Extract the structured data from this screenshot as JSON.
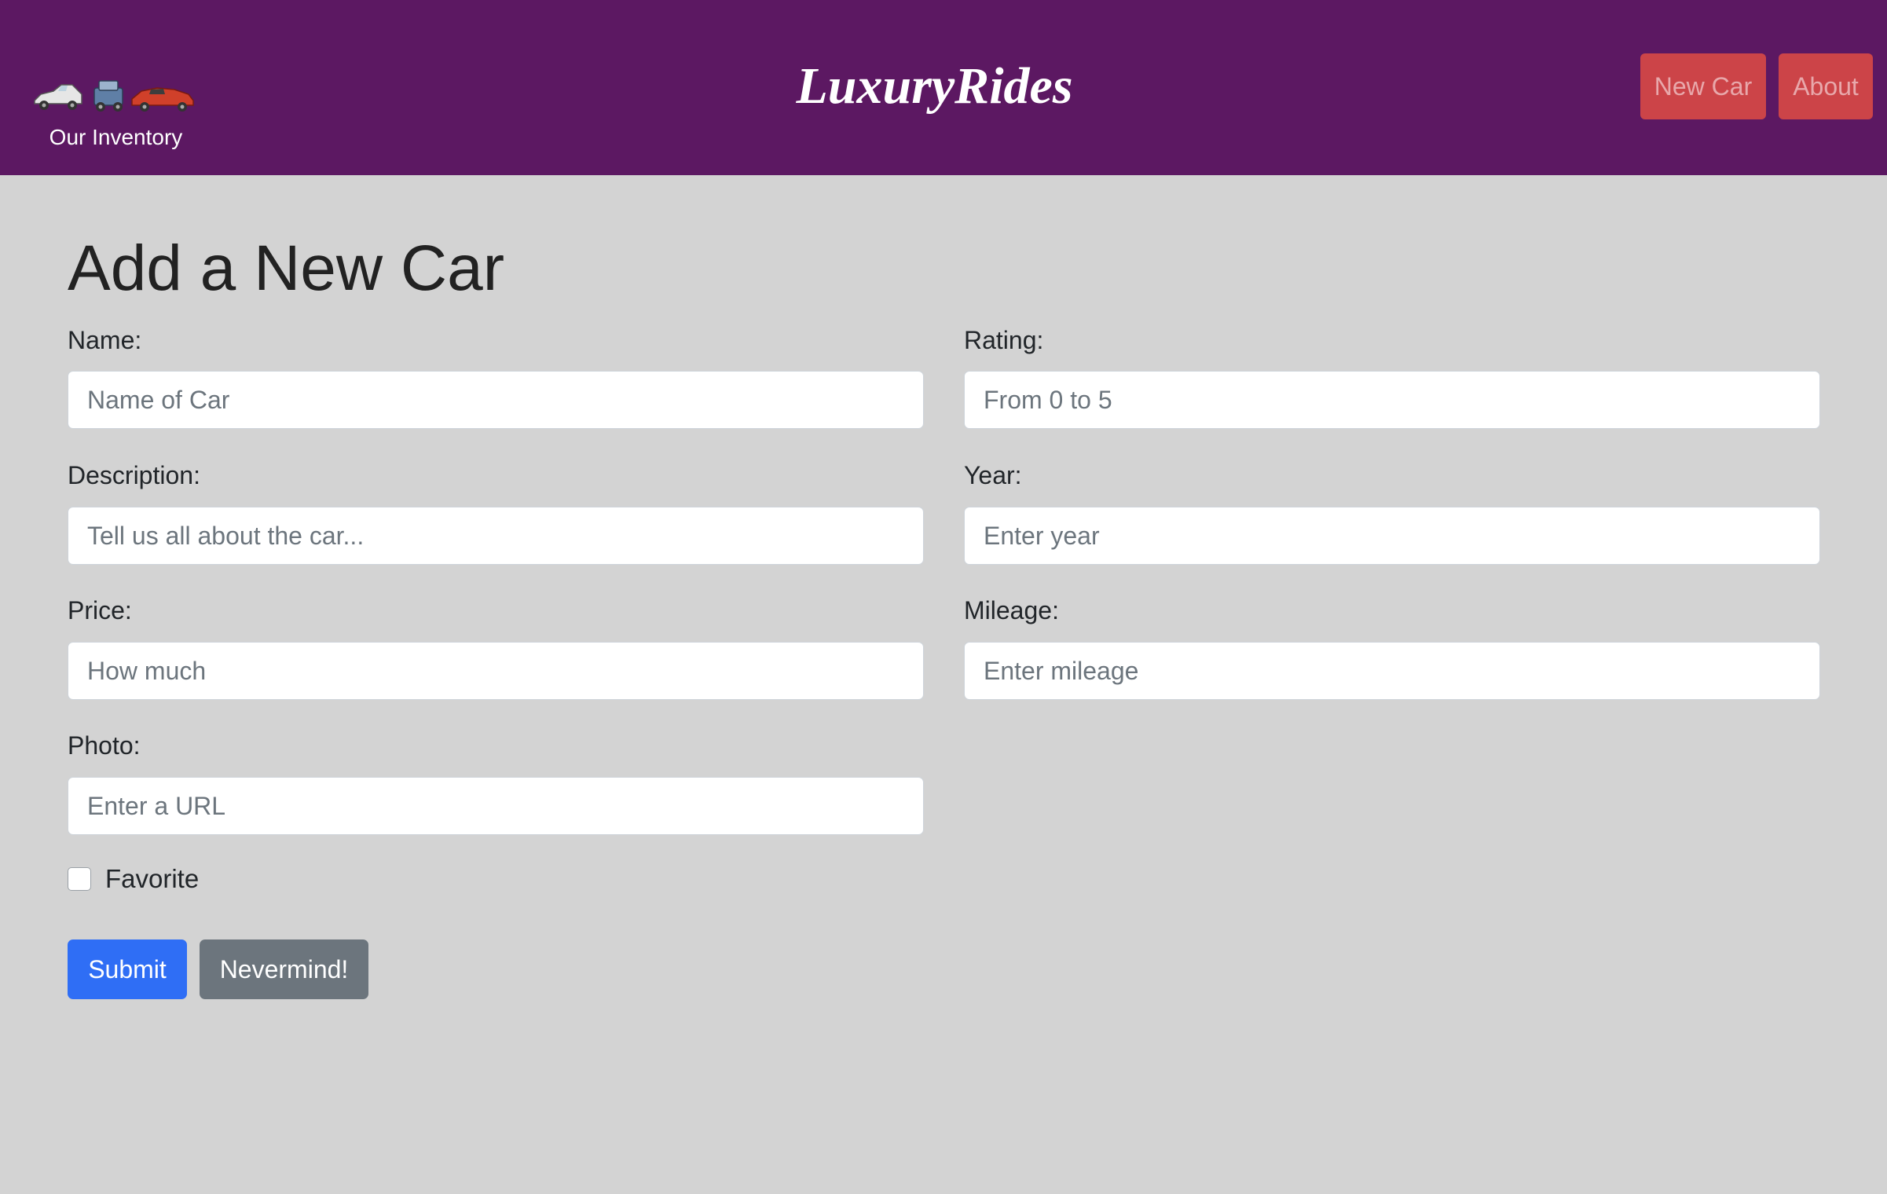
{
  "navbar": {
    "brand_title": "LuxuryRides",
    "inventory_label": "Our Inventory",
    "inventory_icons": [
      "silver-car-icon",
      "blue-car-icon",
      "red-car-icon"
    ],
    "new_car_label": "New Car",
    "about_label": "About",
    "background_color": "#5c1862",
    "button_color": "#cc4448"
  },
  "form": {
    "heading": "Add a New Car",
    "fields": {
      "name": {
        "label": "Name:",
        "placeholder": "Name of Car",
        "value": ""
      },
      "rating": {
        "label": "Rating:",
        "placeholder": "From 0 to 5",
        "value": ""
      },
      "description": {
        "label": "Description:",
        "placeholder": "Tell us all about the car...",
        "value": ""
      },
      "year": {
        "label": "Year:",
        "placeholder": "Enter year",
        "value": ""
      },
      "price": {
        "label": "Price:",
        "placeholder": "How much",
        "value": ""
      },
      "mileage": {
        "label": "Mileage:",
        "placeholder": "Enter mileage",
        "value": ""
      },
      "photo": {
        "label": "Photo:",
        "placeholder": "Enter a URL",
        "value": ""
      }
    },
    "favorite": {
      "label": "Favorite",
      "checked": false
    },
    "submit_label": "Submit",
    "cancel_label": "Nevermind!",
    "submit_color": "#2f6ef5",
    "cancel_color": "#6c757d"
  },
  "page_background": "#d3d3d3"
}
